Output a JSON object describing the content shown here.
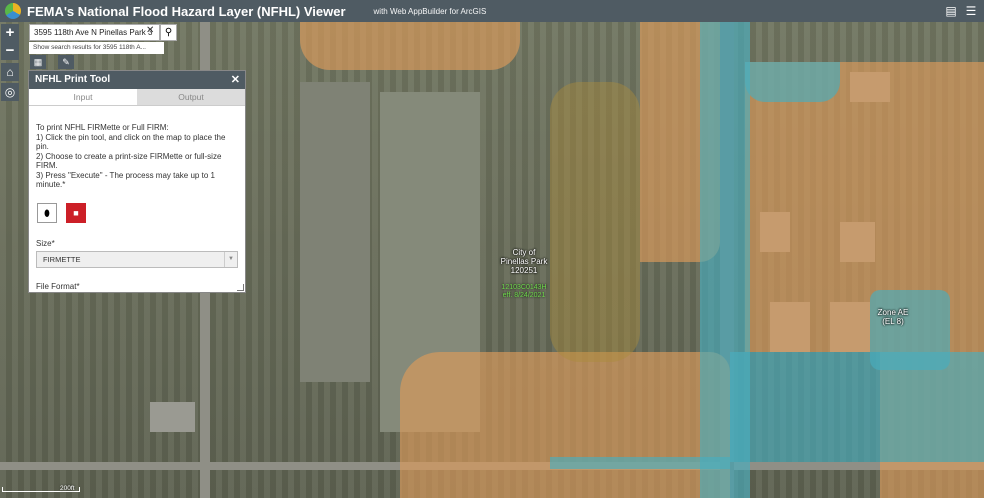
{
  "header": {
    "title": "FEMA's National Flood Hazard Layer (NFHL) Viewer",
    "subtitle": "with Web AppBuilder for ArcGIS"
  },
  "icons": {
    "logo": "agol-logo-icon",
    "zoom_in": "+",
    "zoom_out": "−",
    "home": "home-icon",
    "locate": "locate-icon",
    "search": "search-icon",
    "close": "close-icon",
    "pin": "pin-icon",
    "trash": "trash-icon",
    "table": "table-icon",
    "pencil": "pencil-icon"
  },
  "search": {
    "value": "3595 118th Ave N Pinellas Park 3",
    "clear": "✕",
    "suggestion": "Show search results for 3595 118th A..."
  },
  "print_tool": {
    "title": "NFHL Print Tool",
    "close": "✕",
    "tabs": [
      "Input",
      "Output"
    ],
    "instructions": [
      "To print NFHL FIRMette or Full FIRM:",
      "1) Click the pin tool, and click on the map to place the pin.",
      "2) Choose to create a print-size FIRMette or full-size FIRM.",
      "3) Press \"Execute\" - The process may take up to 1 minute.*"
    ],
    "size_label": "Size*",
    "size_value": "FIRMETTE",
    "format_label": "File Format*"
  },
  "map": {
    "community_label": [
      "City of",
      "Pinellas Park",
      "120251"
    ],
    "panel_label": [
      "12103C0143H",
      "eff. 8/24/2021"
    ],
    "zone_label": [
      "Zone AE",
      "(EL 8)"
    ],
    "scale": "200ft"
  },
  "colors": {
    "header": "#4f5b63",
    "zone_a_fill": "#dd9b5a",
    "zone_ae_fill": "#48aebe",
    "delete_button": "#cc1f27"
  }
}
